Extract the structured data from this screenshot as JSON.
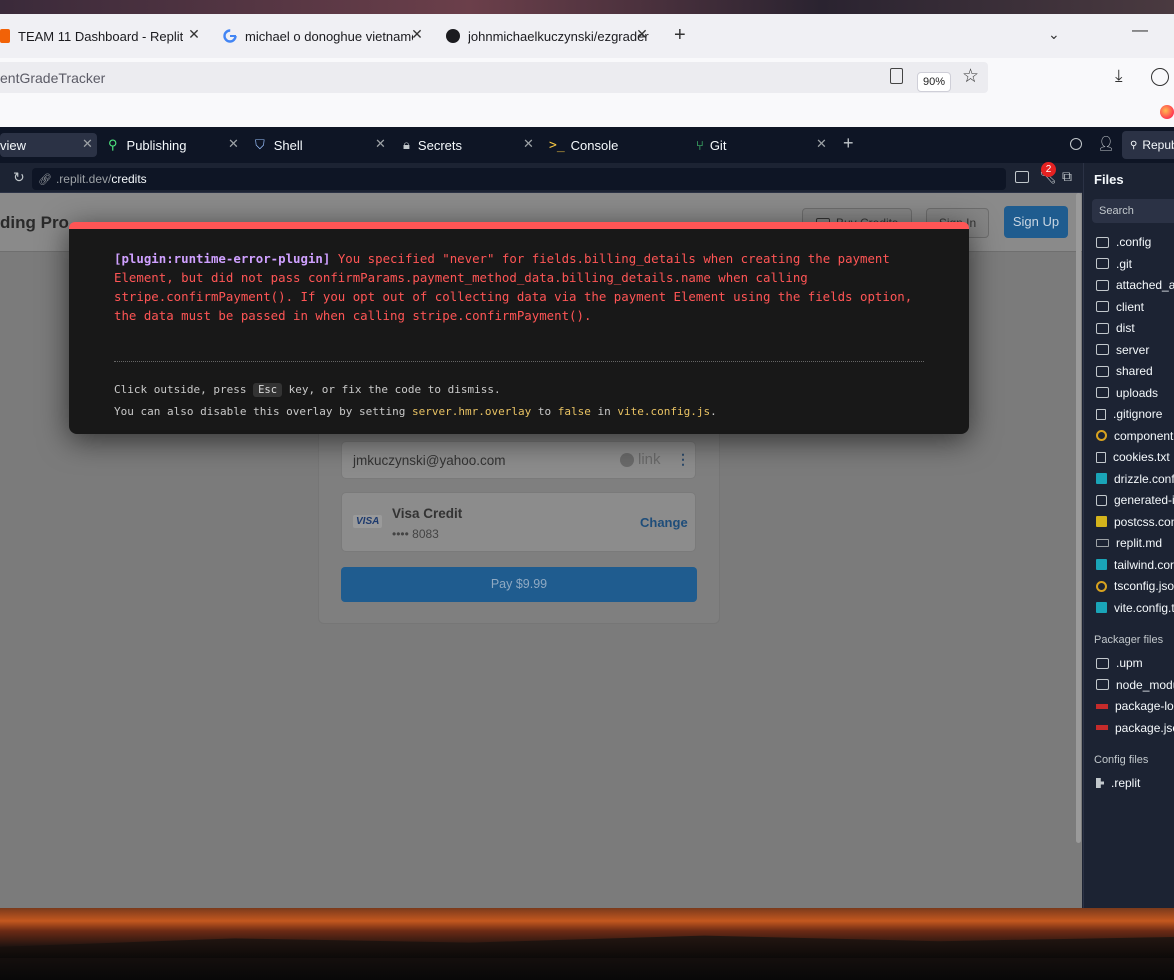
{
  "browser": {
    "tabs": [
      {
        "label": "TEAM 11 Dashboard - Replit",
        "icon": "replit-icon"
      },
      {
        "label": "michael o donoghue vietnames",
        "icon": "google-icon"
      },
      {
        "label": "johnmichaelkuczynski/ezgrader",
        "icon": "github-icon"
      }
    ],
    "url_fragment": "entGradeTracker",
    "zoom": "90%"
  },
  "workspace": {
    "tabs": [
      {
        "label": "view"
      },
      {
        "label": "Publishing"
      },
      {
        "label": "Shell"
      },
      {
        "label": "Secrets"
      },
      {
        "label": "Console"
      },
      {
        "label": "Git"
      }
    ],
    "publish_label": "Repub",
    "address": {
      "host": ".replit.dev/",
      "path": "credits"
    },
    "notification_count": "2"
  },
  "app": {
    "title": "ding Pro",
    "buy_credits": "Buy Credits",
    "sign_in": "Sign In",
    "sign_up": "Sign Up",
    "email": "jmkuczynski@yahoo.com",
    "link_label": "link",
    "card_brand": "VISA",
    "card_name": "Visa Credit",
    "card_number": "•••• 8083",
    "change_label": "Change",
    "pay_label": "Pay $9.99"
  },
  "overlay": {
    "plugin": "[plugin:runtime-error-plugin]",
    "message": "You specified \"never\" for fields.billing_details when creating the payment Element, but did not pass confirmParams.payment_method_data.billing_details.name when calling stripe.confirmPayment(). If you opt out of collecting data via the payment Element using the fields option, the data must be passed in when calling stripe.confirmPayment().",
    "tip1_a": "Click outside, press",
    "tip1_key": "Esc",
    "tip1_b": "key, or fix the code to dismiss.",
    "tip2_a": "You can also disable this overlay by setting",
    "tip2_code1": "server.hmr.overlay",
    "tip2_b": "to",
    "tip2_code2": "false",
    "tip2_c": "in",
    "tip2_code3": "vite.config.js",
    "tip2_d": "."
  },
  "files": {
    "title": "Files",
    "search_placeholder": "Search",
    "items": [
      {
        "label": ".config",
        "kind": "folder"
      },
      {
        "label": ".git",
        "kind": "folder"
      },
      {
        "label": "attached_a",
        "kind": "folder"
      },
      {
        "label": "client",
        "kind": "folder"
      },
      {
        "label": "dist",
        "kind": "folder"
      },
      {
        "label": "server",
        "kind": "folder"
      },
      {
        "label": "shared",
        "kind": "folder"
      },
      {
        "label": "uploads",
        "kind": "folder"
      },
      {
        "label": ".gitignore",
        "kind": "file"
      },
      {
        "label": "component",
        "kind": "json"
      },
      {
        "label": "cookies.txt",
        "kind": "file"
      },
      {
        "label": "drizzle.conf",
        "kind": "ts"
      },
      {
        "label": "generated-i",
        "kind": "image"
      },
      {
        "label": "postcss.con",
        "kind": "js"
      },
      {
        "label": "replit.md",
        "kind": "md"
      },
      {
        "label": "tailwind.cor",
        "kind": "ts"
      },
      {
        "label": "tsconfig.jso",
        "kind": "json"
      },
      {
        "label": "vite.config.t",
        "kind": "ts"
      }
    ],
    "packager_title": "Packager files",
    "packager_items": [
      {
        "label": ".upm",
        "kind": "folder"
      },
      {
        "label": "node_modu",
        "kind": "folder"
      },
      {
        "label": "package-loc",
        "kind": "npm"
      },
      {
        "label": "package.jsc",
        "kind": "npm"
      }
    ],
    "config_title": "Config files",
    "config_items": [
      {
        "label": ".replit",
        "kind": "replit"
      }
    ]
  },
  "colors": {
    "error": "#ff5555",
    "plugin": "#cfa0ff",
    "code": "#e8c263",
    "accent": "#0079f2"
  }
}
